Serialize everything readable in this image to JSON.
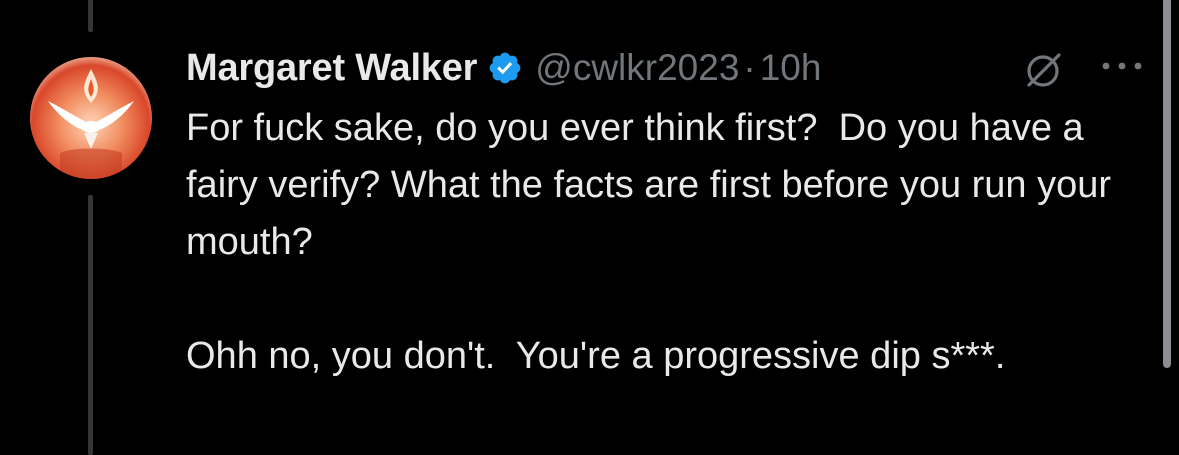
{
  "tweet": {
    "author": {
      "display_name": "Margaret Walker",
      "handle": "@cwlkr2023",
      "verified": true,
      "avatar": "dove-avatar-icon"
    },
    "separator": "·",
    "time": "10h",
    "paragraphs": [
      "For fuck sake, do you ever think first?  Do you have a fairy verify? What the facts are first before you run your mouth?",
      "Ohh no, you don't.  You're a progressive dip s***."
    ]
  },
  "icons": {
    "verified": "verified-badge-icon",
    "grok": "grok-icon",
    "more": "more-options-icon"
  },
  "colors": {
    "background": "#000000",
    "text": "#e7e9ea",
    "secondary": "#71767b",
    "verified": "#1d9bf0"
  }
}
